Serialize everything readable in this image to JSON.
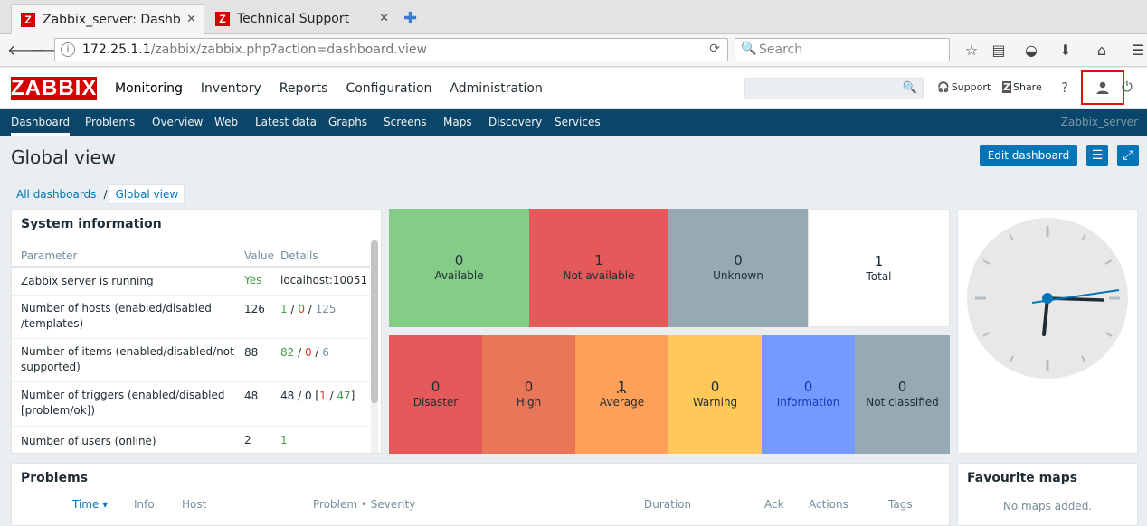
{
  "browser": {
    "tabs": [
      {
        "title": "Zabbix_server: Dashb",
        "active": true
      },
      {
        "title": "Technical Support",
        "active": false
      }
    ],
    "url_host": "172.25.1.1",
    "url_path": "/zabbix/zabbix.php?action=dashboard.view",
    "search_placeholder": "Search"
  },
  "header": {
    "logo": "ZABBIX",
    "menu": [
      "Monitoring",
      "Inventory",
      "Reports",
      "Configuration",
      "Administration"
    ],
    "support_label": "Support",
    "share_label": "Share",
    "help_label": "?"
  },
  "submenu": {
    "items": [
      "Dashboard",
      "Problems",
      "Overview",
      "Web",
      "Latest data",
      "Graphs",
      "Screens",
      "Maps",
      "Discovery",
      "Services"
    ],
    "server_name": "Zabbix_server"
  },
  "page": {
    "title": "Global view",
    "edit_button": "Edit dashboard",
    "breadcrumb_all": "All dashboards",
    "breadcrumb_sep": "/",
    "breadcrumb_current": "Global view"
  },
  "system_info": {
    "title": "System information",
    "headers": [
      "Parameter",
      "Value",
      "Details"
    ],
    "rows": [
      {
        "param": "Zabbix server is running",
        "value": "Yes",
        "details": "localhost:10051"
      },
      {
        "param": "Number of hosts (enabled/disabled /templates)",
        "value": "126",
        "d1": "1",
        "d2": "0",
        "d3": "125"
      },
      {
        "param": "Number of items (enabled/disabled/not supported)",
        "value": "88",
        "d1": "82",
        "d2": "0",
        "d3": "6"
      },
      {
        "param": "Number of triggers (enabled/disabled [problem/ok])",
        "value": "48",
        "d_prefix": "48 / 0 [",
        "d1": "1",
        "d_sep": " / ",
        "d2": "47",
        "d_suffix": "]"
      },
      {
        "param": "Number of users (online)",
        "value": "2",
        "details": "1"
      }
    ]
  },
  "host_status": [
    {
      "count": "0",
      "label": "Available",
      "color": "#86cc89"
    },
    {
      "count": "1",
      "label": "Not available",
      "color": "#e45959"
    },
    {
      "count": "0",
      "label": "Unknown",
      "color": "#97aab3"
    },
    {
      "count": "1",
      "label": "Total",
      "color": "#ffffff"
    }
  ],
  "triggers": [
    {
      "count": "0",
      "label": "Disaster",
      "color": "#e45959"
    },
    {
      "count": "0",
      "label": "High",
      "color": "#e97659"
    },
    {
      "count": "1",
      "label": "Average",
      "color": "#ffa059"
    },
    {
      "count": "0",
      "label": "Warning",
      "color": "#ffc859"
    },
    {
      "count": "0",
      "label": "Information",
      "color": "#7499ff"
    },
    {
      "count": "0",
      "label": "Not classified",
      "color": "#97aab3"
    }
  ],
  "problems": {
    "title": "Problems",
    "headers": [
      "Time ▾",
      "Info",
      "Host",
      "Problem • Severity",
      "Duration",
      "Ack",
      "Actions",
      "Tags"
    ]
  },
  "fav_maps": {
    "title": "Favourite maps",
    "empty": "No maps added."
  }
}
